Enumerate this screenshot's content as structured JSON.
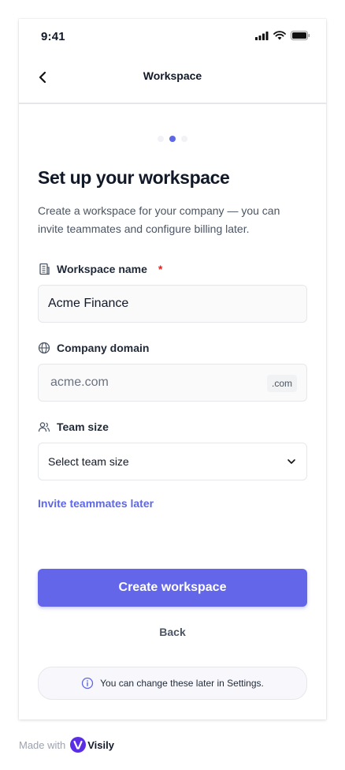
{
  "status_bar": {
    "time": "9:41"
  },
  "nav": {
    "title": "Workspace"
  },
  "progress": {
    "steps": 3,
    "current": 2
  },
  "page": {
    "heading": "Set up your workspace",
    "subtitle": "Create a workspace for your company — you can invite teammates and configure billing later."
  },
  "workspace_name": {
    "label": "Workspace name",
    "required_mark": "*",
    "value": "Acme Finance"
  },
  "company_domain": {
    "label": "Company domain",
    "placeholder": "acme.com",
    "suffix": ".com"
  },
  "team_size": {
    "label": "Team size",
    "selected": "Select team size"
  },
  "invite_link": "Invite teammates later",
  "actions": {
    "primary": "Create workspace",
    "secondary": "Back"
  },
  "notice": "You can change these later in Settings.",
  "footer": {
    "made_with": "Made with",
    "brand": "Visily"
  },
  "colors": {
    "accent": "#6366e8",
    "required": "#dc2626",
    "border": "#e5e7eb"
  }
}
